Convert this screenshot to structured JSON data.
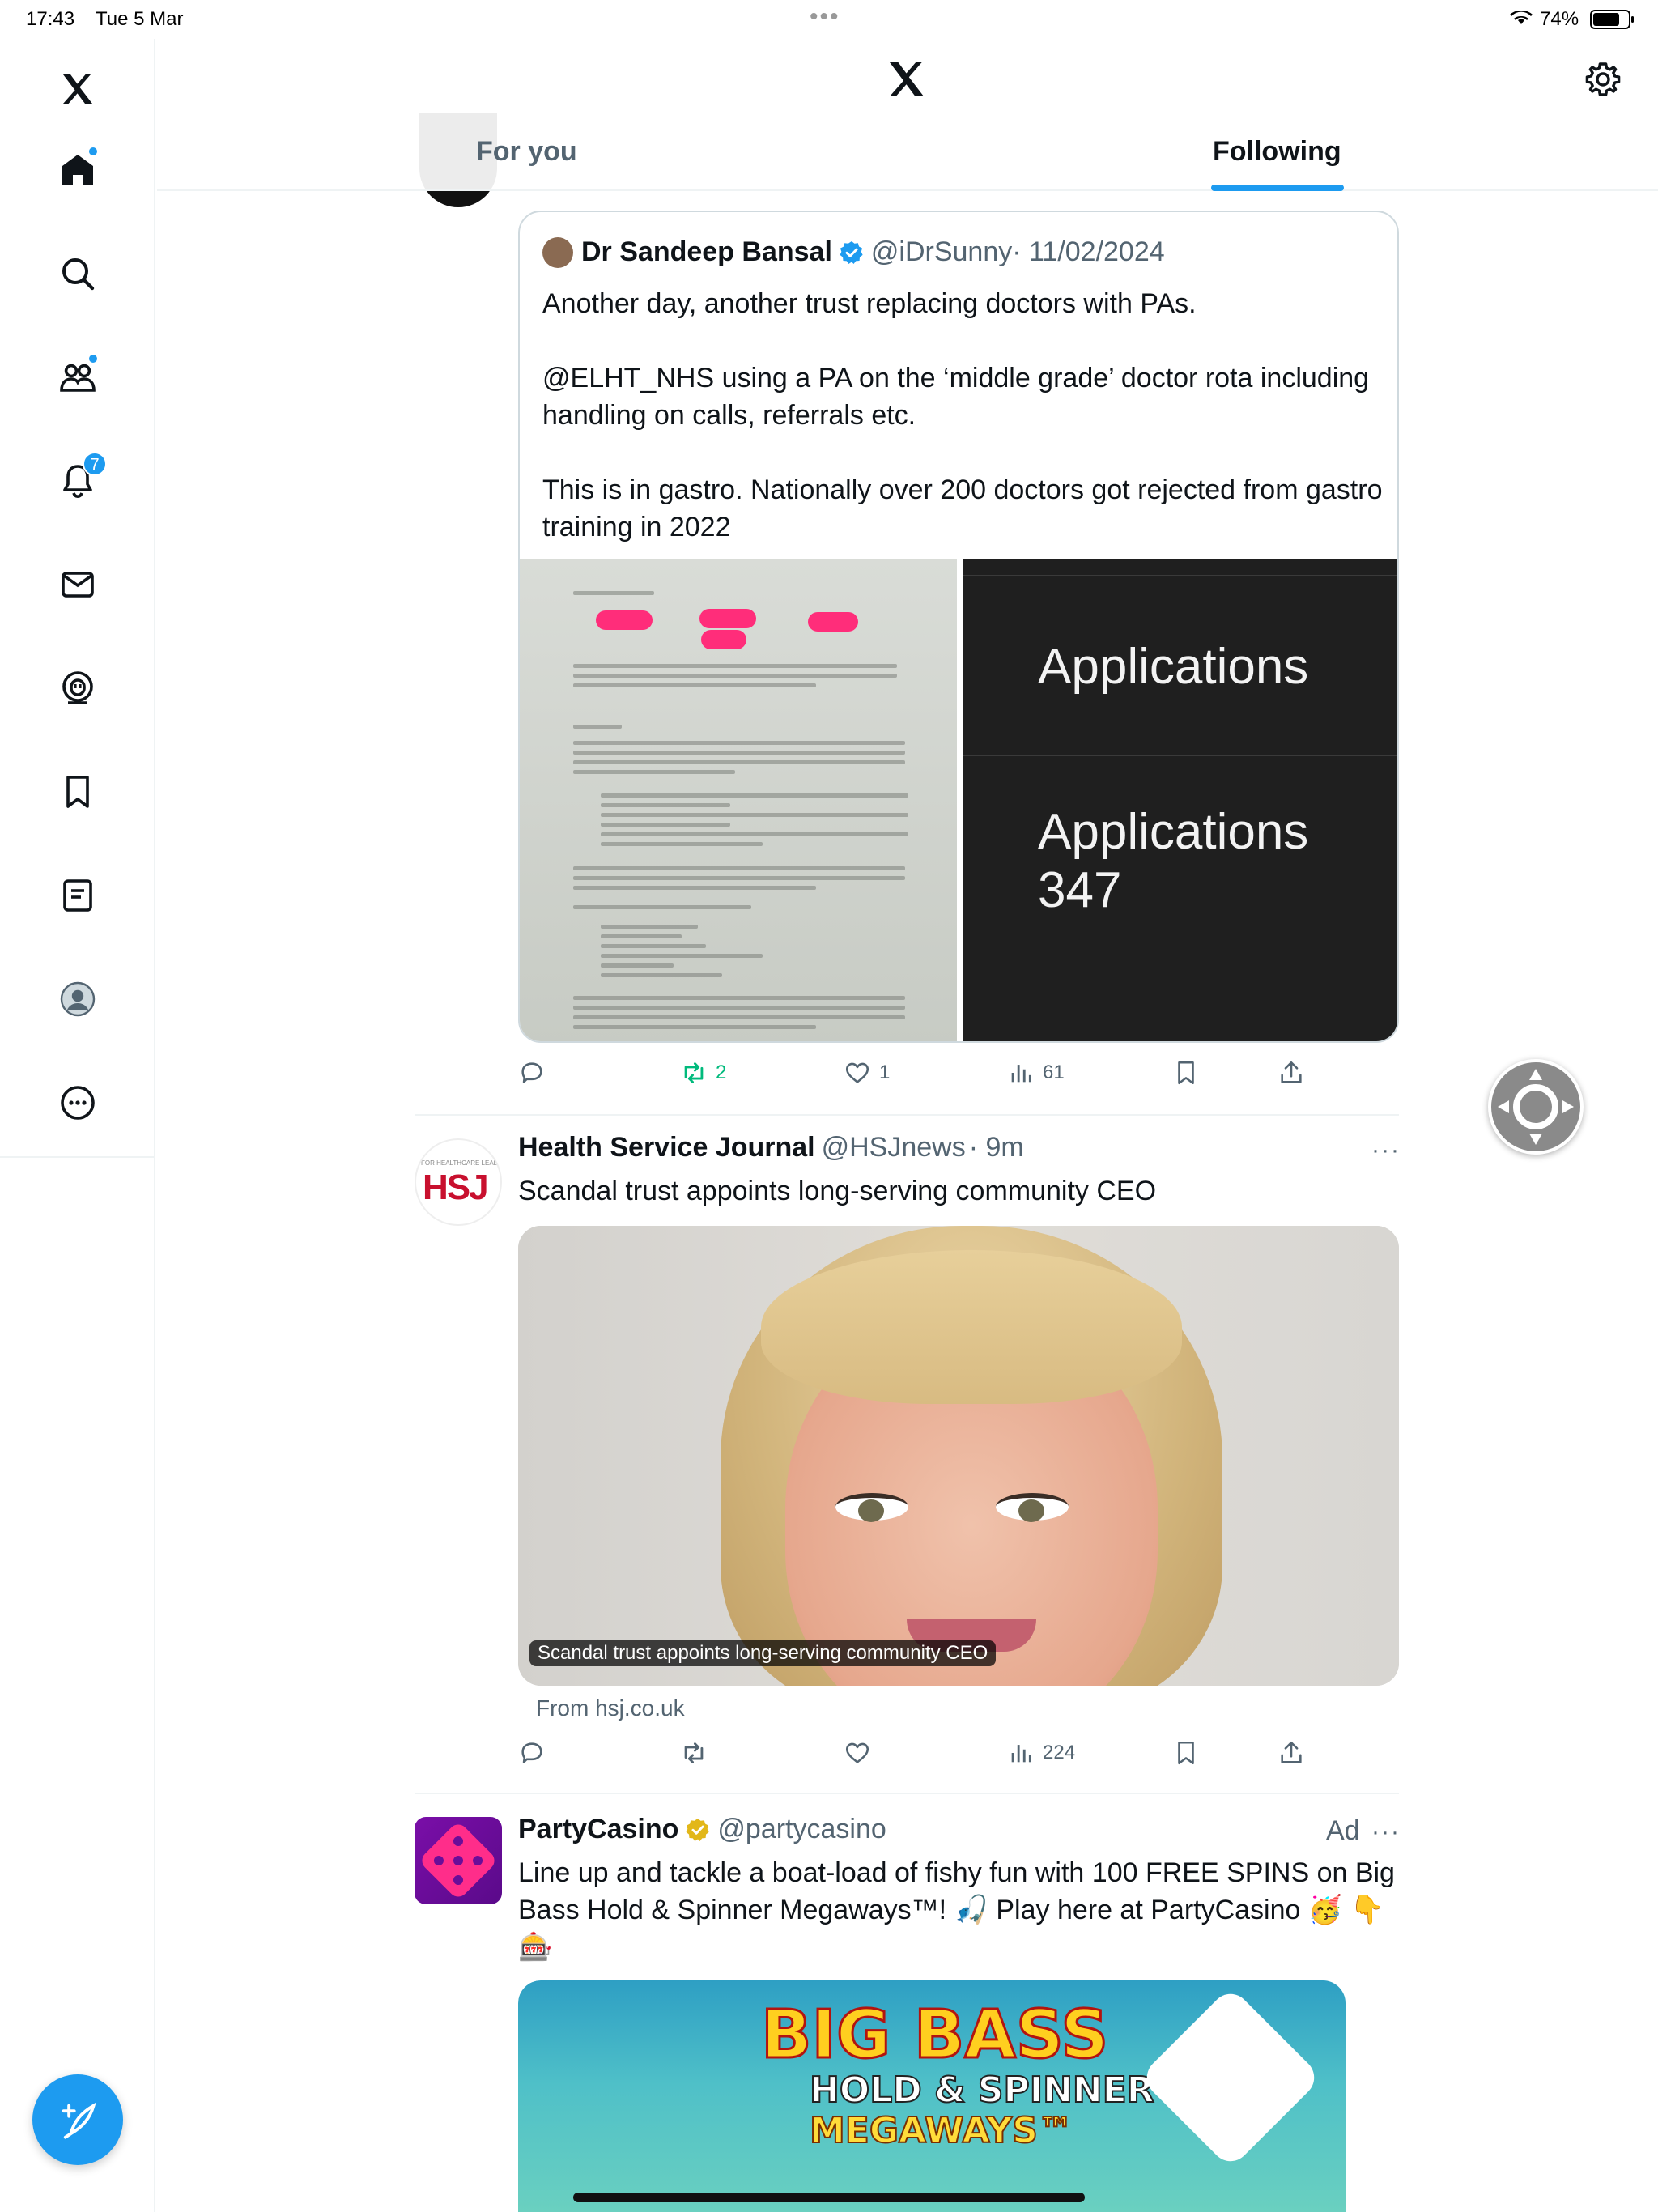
{
  "status": {
    "time": "17:43",
    "date": "Tue 5 Mar",
    "battery": "74%",
    "battery_level": 0.74
  },
  "sidebar": {
    "items": [
      {
        "name": "x-logo",
        "icon": "x-logo-icon"
      },
      {
        "name": "home",
        "icon": "home-icon",
        "dot": true
      },
      {
        "name": "explore",
        "icon": "search-icon"
      },
      {
        "name": "communities",
        "icon": "people-icon",
        "dot": true
      },
      {
        "name": "notifications",
        "icon": "bell-icon",
        "badge": "7"
      },
      {
        "name": "messages",
        "icon": "mail-icon"
      },
      {
        "name": "grok",
        "icon": "grok-icon"
      },
      {
        "name": "bookmarks",
        "icon": "bookmark-icon"
      },
      {
        "name": "lists",
        "icon": "list-icon"
      },
      {
        "name": "profile",
        "icon": "avatar-icon"
      },
      {
        "name": "more",
        "icon": "more-icon"
      }
    ],
    "compose_icon": "feather-plus-icon"
  },
  "header": {
    "tabs": [
      {
        "label": "For you",
        "active": false
      },
      {
        "label": "Following",
        "active": true
      }
    ],
    "settings_icon": "gear-icon"
  },
  "feed": {
    "post1": {
      "quote": {
        "name": "Dr Sandeep Bansal",
        "verified": true,
        "handle": "@iDrSunny",
        "date": "· 11/02/2024",
        "text": "Another day, another trust replacing doctors with PAs.\n\n@ELHT_NHS using a PA on the ‘middle grade’ doctor rota including handling on calls, referrals etc.\n\nThis is in gastro. Nationally over 200 doctors got rejected from gastro training in 2022",
        "image_right": {
          "line1": "Applications",
          "line2": "Applications",
          "line3": "347"
        }
      },
      "stats": {
        "replies": "",
        "reposts": "2",
        "likes": "1",
        "views": "61"
      }
    },
    "post2": {
      "name": "Health Service Journal",
      "handle": "@HSJnews",
      "time": "· 9m",
      "text": "Scandal trust appoints long-serving community CEO",
      "avatar_text": "HSJ",
      "avatar_small": "FOR HEALTHCARE LEADERS",
      "card_caption": "Scandal trust appoints long-serving community CEO",
      "from": "From hsj.co.uk",
      "stats": {
        "replies": "",
        "reposts": "",
        "likes": "",
        "views": "224"
      }
    },
    "post3": {
      "name": "PartyCasino",
      "verified_gold": true,
      "handle": "@partycasino",
      "ad": "Ad",
      "text": "Line up and tackle a boat-load of fishy fun with 100 FREE SPINS on Big Bass Hold & Spinner Megaways™! 🎣 Play here at PartyCasino 🥳 👇 🎰",
      "media": {
        "title1": "BIG BASS",
        "title2": "HOLD & SPINNER",
        "title3": "MEGAWAYS™"
      }
    }
  },
  "colors": {
    "accent": "#1d9bf0",
    "repost_green": "#00ba7c",
    "gold": "#e2b719"
  }
}
